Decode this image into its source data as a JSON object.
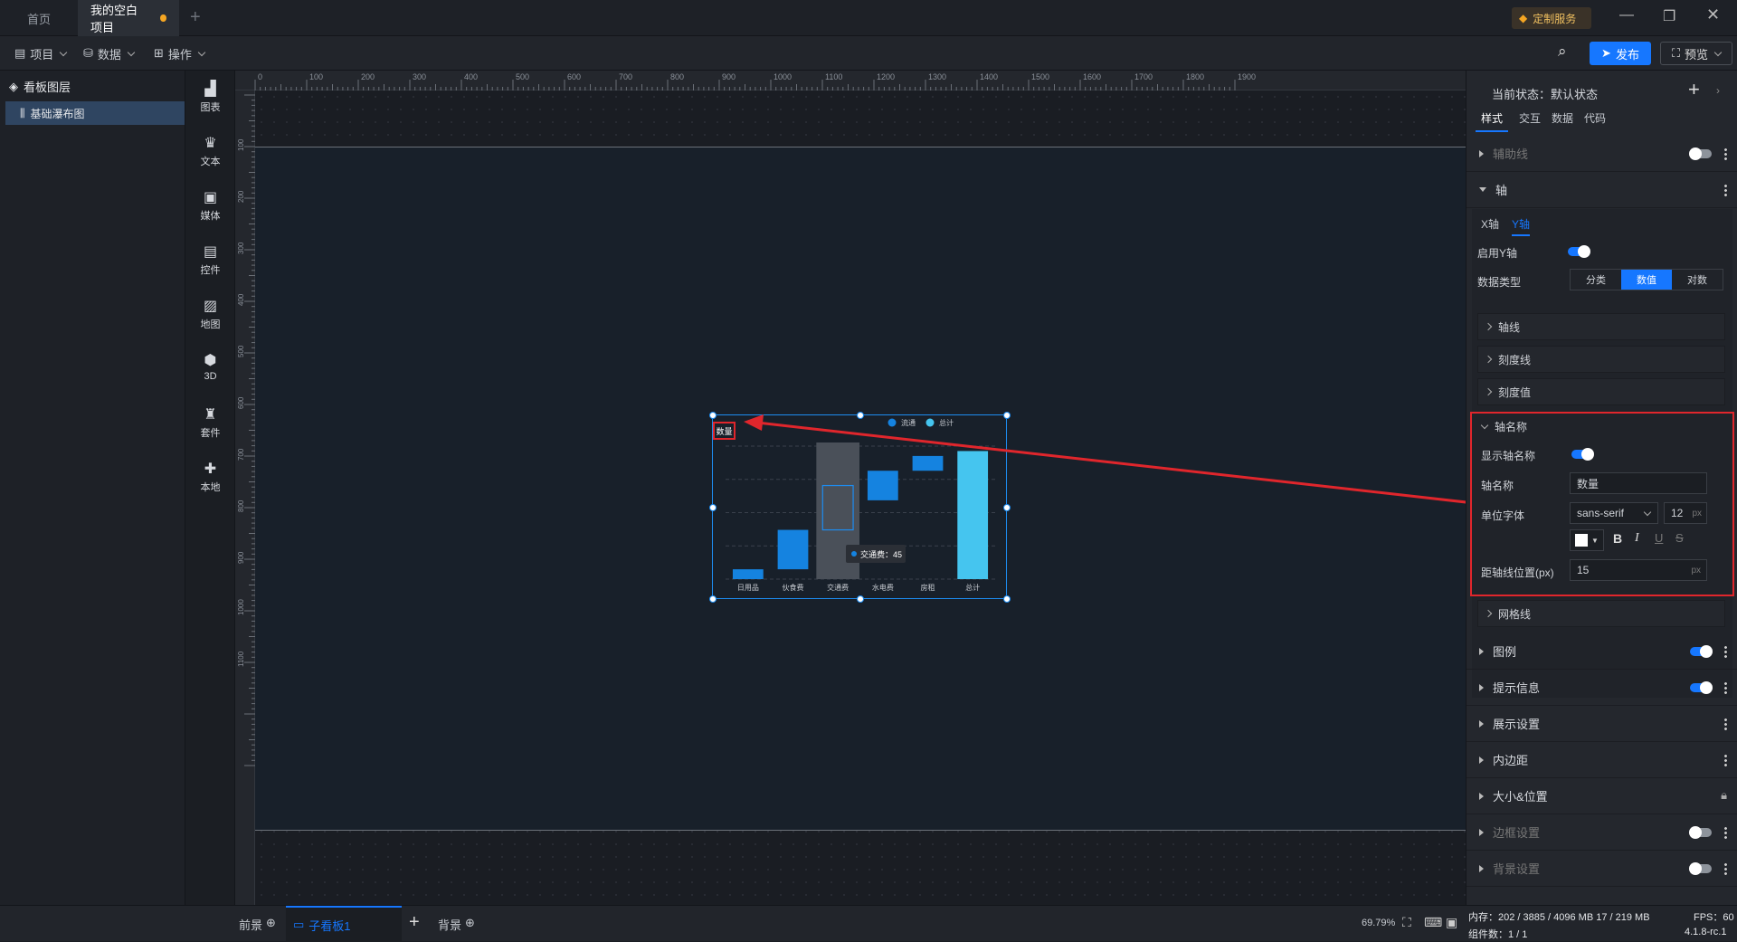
{
  "tabs": {
    "home": "首页",
    "project": "我的空白项目",
    "custom_service": "定制服务"
  },
  "toolbar": {
    "project": "项目",
    "data": "数据",
    "ops": "操作",
    "publish": "发布",
    "preview": "预览"
  },
  "layers": {
    "title": "看板图层",
    "item": "基础瀑布图"
  },
  "components": [
    "图表",
    "文本",
    "媒体",
    "控件",
    "地图",
    "3D",
    "套件",
    "本地"
  ],
  "ruler": {
    "x_ticks": [
      "0",
      "100",
      "200",
      "300",
      "400",
      "500",
      "600",
      "700",
      "800",
      "900",
      "1000",
      "1100",
      "1200",
      "1300",
      "1400",
      "1500",
      "1600",
      "1700",
      "1800",
      "1900"
    ],
    "y_ticks": [
      "100",
      "200",
      "300",
      "400",
      "500",
      "600",
      "700",
      "800",
      "900",
      "1000",
      "1100"
    ]
  },
  "chart": {
    "axis_name": "数量",
    "legend": [
      "流通",
      "总计"
    ],
    "tooltip": "交通费：45",
    "colors": {
      "bar": "#1583e0",
      "total": "#45c5ef",
      "highlight": "#4a5059",
      "annot": "#e0262c"
    }
  },
  "chart_data": {
    "type": "bar",
    "categories": [
      "日用品",
      "伙食费",
      "交通费",
      "水电费",
      "房租",
      "总计"
    ],
    "series": [
      {
        "name": "流通",
        "base": [
          0,
          10,
          50,
          80,
          110,
          0
        ],
        "values": [
          10,
          40,
          45,
          30,
          15,
          130
        ]
      }
    ],
    "ylim": [
      0,
      135
    ],
    "grid": true,
    "legend_position": "top-right"
  },
  "panel": {
    "state": "当前状态：默认状态",
    "tabs": [
      "样式",
      "交互",
      "数据",
      "代码"
    ],
    "aux_line": "辅助线",
    "axis": "轴",
    "axis_tabs": [
      "X轴",
      "Y轴"
    ],
    "enable_y": "启用Y轴",
    "data_type": "数据类型",
    "type_options": [
      "分类",
      "数值",
      "对数"
    ],
    "axis_line": "轴线",
    "tick_line": "刻度线",
    "tick_value": "刻度值",
    "axis_name_sec": "轴名称",
    "show_axis_name": "显示轴名称",
    "axis_name_label": "轴名称",
    "axis_name_value": "数量",
    "font_label": "单位字体",
    "font_value": "sans-serif",
    "font_size": "12",
    "px": "px",
    "offset_label": "距轴线位置(px)",
    "offset_value": "15",
    "grid_line": "网格线",
    "sections": [
      "图例",
      "提示信息",
      "展示设置",
      "内边距",
      "大小&位置",
      "边框设置",
      "背景设置"
    ]
  },
  "bottom": {
    "front": "前景",
    "sub_board": "子看板1",
    "back": "背景",
    "zoom": "69.79%",
    "mem": "内存：202 / 3885 / 4096 MB  17 / 219 MB",
    "fps": "FPS：60",
    "count": "组件数：1 / 1",
    "version": "4.1.8-rc.1"
  }
}
